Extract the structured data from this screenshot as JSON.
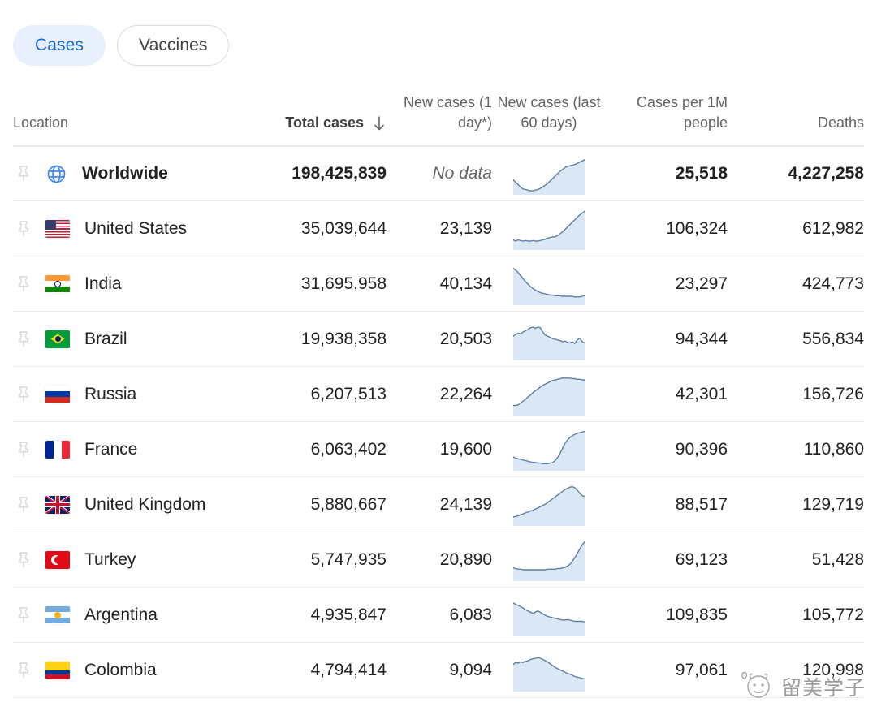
{
  "tabs": [
    {
      "label": "Cases",
      "active": true,
      "name": "tab-cases"
    },
    {
      "label": "Vaccines",
      "active": false,
      "name": "tab-vaccines"
    }
  ],
  "colors": {
    "tab_active_bg": "#e8f0fe",
    "tab_active_text": "#1967d2",
    "tab_inactive_border": "#dadce0",
    "spark_line": "#5b7fa6",
    "spark_fill": "#dce7f5",
    "row_divider": "#e8eaed",
    "text_primary": "#202124",
    "text_secondary": "#5f6368",
    "globe_icon": "#4285f4",
    "pin_icon": "#dadce0"
  },
  "headers": {
    "location": "Location",
    "total_cases": "Total cases",
    "new_cases_1day": "New cases (1 day*)",
    "new_cases_60days": "New cases (last 60 days)",
    "cases_per_1m": "Cases per 1M people",
    "deaths": "Deaths",
    "sort_indicator": "descending"
  },
  "rows": [
    {
      "pin": "pin-icon",
      "flag": "globe-icon",
      "location": "Worldwide",
      "total_cases": "198,425,839",
      "new_cases": "No data",
      "new_cases_is_nodata": true,
      "cases_per_1m": "25,518",
      "deaths": "4,227,258",
      "bold": true,
      "sparkline": [
        42,
        46,
        50,
        54,
        57,
        58,
        59,
        60,
        60,
        59,
        58,
        56,
        54,
        51,
        48,
        44,
        40,
        36,
        32,
        28,
        25,
        22,
        20,
        19,
        18,
        17,
        15,
        13,
        11,
        9
      ]
    },
    {
      "pin": "pin-icon",
      "flag": "flag-united-states",
      "location": "United States",
      "total_cases": "35,039,644",
      "new_cases": "23,139",
      "new_cases_is_nodata": false,
      "cases_per_1m": "106,324",
      "deaths": "612,982",
      "bold": false,
      "sparkline": [
        50,
        52,
        50,
        51,
        52,
        51,
        52,
        52,
        51,
        52,
        52,
        51,
        50,
        49,
        47,
        46,
        45,
        45,
        43,
        40,
        37,
        33,
        29,
        25,
        21,
        17,
        13,
        9,
        6,
        3
      ]
    },
    {
      "pin": "pin-icon",
      "flag": "flag-india",
      "location": "India",
      "total_cases": "31,695,958",
      "new_cases": "40,134",
      "new_cases_is_nodata": false,
      "cases_per_1m": "23,297",
      "deaths": "424,773",
      "bold": false,
      "sparkline": [
        6,
        9,
        13,
        18,
        23,
        28,
        32,
        36,
        39,
        42,
        44,
        46,
        47,
        48,
        49,
        50,
        50,
        51,
        51,
        51,
        52,
        52,
        52,
        52,
        52,
        53,
        53,
        53,
        52,
        51
      ]
    },
    {
      "pin": "pin-icon",
      "flag": "flag-brazil",
      "location": "Brazil",
      "total_cases": "19,938,358",
      "new_cases": "20,503",
      "new_cases_is_nodata": false,
      "cases_per_1m": "94,344",
      "deaths": "556,834",
      "bold": false,
      "sparkline": [
        27,
        24,
        22,
        23,
        20,
        18,
        16,
        13,
        12,
        14,
        12,
        13,
        20,
        25,
        27,
        29,
        31,
        32,
        33,
        34,
        36,
        35,
        37,
        38,
        36,
        39,
        33,
        30,
        36,
        38
      ]
    },
    {
      "pin": "pin-icon",
      "flag": "flag-russia",
      "location": "Russia",
      "total_cases": "6,207,513",
      "new_cases": "22,264",
      "new_cases_is_nodata": false,
      "cases_per_1m": "42,301",
      "deaths": "156,726",
      "bold": false,
      "sparkline": [
        50,
        50,
        49,
        46,
        43,
        40,
        36,
        33,
        29,
        26,
        23,
        20,
        17,
        15,
        13,
        11,
        9,
        8,
        7,
        6,
        5,
        5,
        5,
        5,
        6,
        6,
        7,
        7,
        8,
        8
      ]
    },
    {
      "pin": "pin-icon",
      "flag": "flag-france",
      "location": "France",
      "total_cases": "6,063,402",
      "new_cases": "19,600",
      "new_cases_is_nodata": false,
      "cases_per_1m": "90,396",
      "deaths": "110,860",
      "bold": false,
      "sparkline": [
        44,
        46,
        47,
        48,
        49,
        50,
        51,
        52,
        53,
        53,
        54,
        54,
        55,
        55,
        55,
        54,
        53,
        50,
        45,
        38,
        30,
        22,
        16,
        12,
        9,
        7,
        5,
        4,
        3,
        2
      ]
    },
    {
      "pin": "pin-icon",
      "flag": "flag-united-kingdom",
      "location": "United Kingdom",
      "total_cases": "5,880,667",
      "new_cases": "24,139",
      "new_cases_is_nodata": false,
      "cases_per_1m": "88,517",
      "deaths": "129,719",
      "bold": false,
      "sparkline": [
        52,
        51,
        50,
        48,
        47,
        45,
        44,
        42,
        41,
        39,
        37,
        35,
        33,
        31,
        28,
        25,
        22,
        19,
        16,
        13,
        10,
        7,
        5,
        3,
        2,
        4,
        8,
        13,
        17,
        18
      ]
    },
    {
      "pin": "pin-icon",
      "flag": "flag-turkey",
      "location": "Turkey",
      "total_cases": "5,747,935",
      "new_cases": "20,890",
      "new_cases_is_nodata": false,
      "cases_per_1m": "69,123",
      "deaths": "51,428",
      "bold": false,
      "sparkline": [
        45,
        46,
        47,
        47,
        48,
        48,
        48,
        48,
        48,
        48,
        48,
        48,
        48,
        48,
        47,
        47,
        47,
        47,
        46,
        46,
        45,
        44,
        42,
        39,
        34,
        28,
        21,
        14,
        7,
        2
      ]
    },
    {
      "pin": "pin-icon",
      "flag": "flag-argentina",
      "location": "Argentina",
      "total_cases": "4,935,847",
      "new_cases": "6,083",
      "new_cases_is_nodata": false,
      "cases_per_1m": "109,835",
      "deaths": "105,772",
      "bold": false,
      "sparkline": [
        12,
        14,
        16,
        18,
        20,
        23,
        25,
        27,
        29,
        27,
        25,
        27,
        30,
        32,
        34,
        35,
        36,
        37,
        38,
        39,
        40,
        40,
        39,
        40,
        41,
        42,
        42,
        42,
        42,
        43
      ]
    },
    {
      "pin": "pin-icon",
      "flag": "flag-colombia",
      "location": "Colombia",
      "total_cases": "4,794,414",
      "new_cases": "9,094",
      "new_cases_is_nodata": false,
      "cases_per_1m": "97,061",
      "deaths": "120,998",
      "bold": false,
      "sparkline": [
        22,
        19,
        20,
        18,
        19,
        17,
        16,
        14,
        13,
        12,
        11,
        12,
        14,
        16,
        18,
        21,
        24,
        27,
        29,
        31,
        33,
        35,
        37,
        38,
        40,
        42,
        43,
        44,
        45,
        46
      ]
    }
  ],
  "watermark": {
    "text": "留美学子",
    "icon": "smiley-face-icon"
  }
}
